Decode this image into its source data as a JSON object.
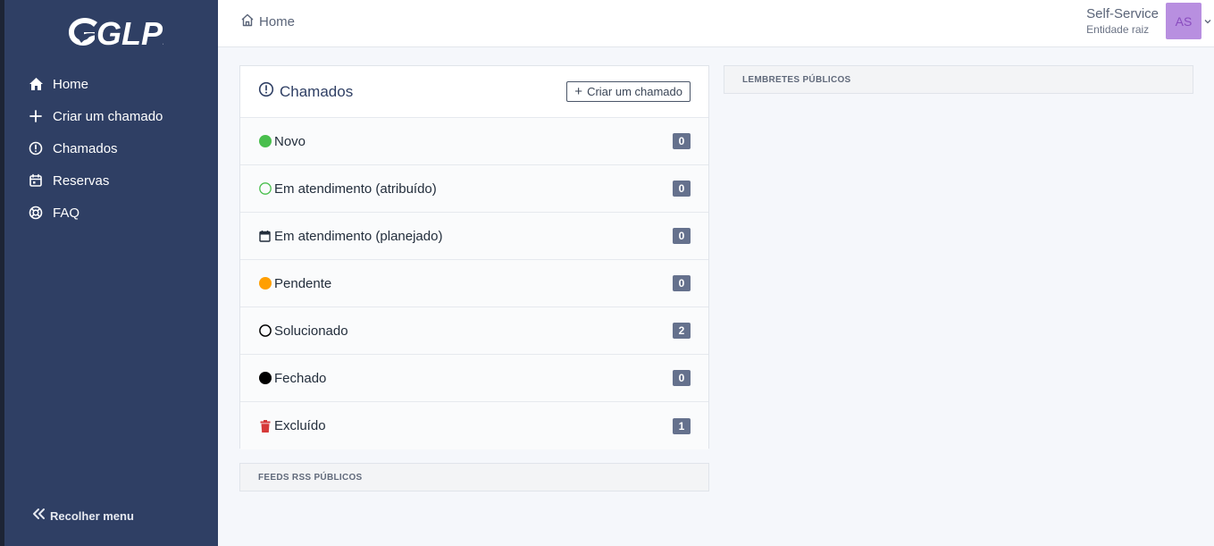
{
  "app": {
    "logo_text": "GLPI"
  },
  "sidebar": {
    "items": [
      {
        "label": "Home",
        "icon": "home-icon"
      },
      {
        "label": "Criar um chamado",
        "icon": "plus-icon"
      },
      {
        "label": "Chamados",
        "icon": "alert-circle-icon"
      },
      {
        "label": "Reservas",
        "icon": "calendar-icon"
      },
      {
        "label": "FAQ",
        "icon": "lifebuoy-icon"
      }
    ],
    "collapse_label": "Recolher menu"
  },
  "breadcrumb": {
    "label": "Home"
  },
  "user": {
    "profile": "Self-Service",
    "entity": "Entidade raiz",
    "initials": "AS"
  },
  "tickets": {
    "title": "Chamados",
    "create_label": "Criar um chamado",
    "rows": [
      {
        "label": "Novo",
        "count": "0",
        "icon": "new-status-dot-icon",
        "color": "#49bf4d"
      },
      {
        "label": "Em atendimento (atribuído)",
        "count": "0",
        "icon": "assigned-status-ring-icon",
        "color": "#49bf4d"
      },
      {
        "label": "Em atendimento (planejado)",
        "count": "0",
        "icon": "calendar-status-icon",
        "color": "#232e3c"
      },
      {
        "label": "Pendente",
        "count": "0",
        "icon": "pending-status-dot-icon",
        "color": "#ff9f00"
      },
      {
        "label": "Solucionado",
        "count": "2",
        "icon": "solved-status-ring-icon",
        "color": "#000000"
      },
      {
        "label": "Fechado",
        "count": "0",
        "icon": "closed-status-dot-icon",
        "color": "#000000"
      },
      {
        "label": "Excluído",
        "count": "1",
        "icon": "trash-icon",
        "color": "#d63939"
      }
    ]
  },
  "rss": {
    "title": "FEEDS RSS PÚBLICOS"
  },
  "reminders": {
    "title": "LEMBRETES PÚBLICOS"
  },
  "colors": {
    "sidebar": "#2f3f64",
    "badge": "#65718d",
    "avatar": "#b88fe0"
  }
}
